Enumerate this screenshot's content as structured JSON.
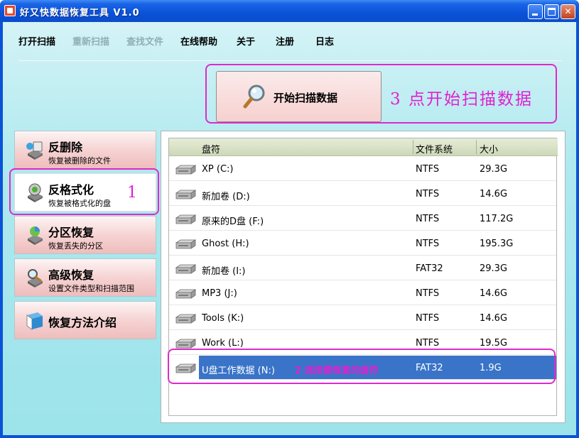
{
  "window": {
    "title": "好又快数据恢复工具 V1.0"
  },
  "menu": [
    {
      "label": "打开扫描",
      "enabled": true
    },
    {
      "label": "重新扫描",
      "enabled": false
    },
    {
      "label": "查找文件",
      "enabled": false
    },
    {
      "label": "在线帮助",
      "enabled": true
    },
    {
      "label": "关于",
      "enabled": true
    },
    {
      "label": "注册",
      "enabled": true
    },
    {
      "label": "日志",
      "enabled": true
    }
  ],
  "scan": {
    "label": "开始扫描数据",
    "annotation": "3 点开始扫描数据"
  },
  "sidebar": {
    "items": [
      {
        "title": "反删除",
        "subtitle": "恢复被删除的文件",
        "icon": "undelete-icon",
        "active": false
      },
      {
        "title": "反格式化",
        "subtitle": "恢复被格式化的盘",
        "icon": "unformat-icon",
        "active": true
      },
      {
        "title": "分区恢复",
        "subtitle": "恢复丢失的分区",
        "icon": "partition-icon",
        "active": false
      },
      {
        "title": "高级恢复",
        "subtitle": "设置文件类型和扫描范围",
        "icon": "advanced-icon",
        "active": false
      },
      {
        "title": "恢复方法介绍",
        "subtitle": "",
        "icon": "book-icon",
        "active": false
      }
    ],
    "annotation": "1"
  },
  "drives": {
    "columns": {
      "name": "盘符",
      "fs": "文件系统",
      "size": "大小"
    },
    "rows": [
      {
        "name": "XP (C:)",
        "fs": "NTFS",
        "size": "29.3G"
      },
      {
        "name": "新加卷 (D:)",
        "fs": "NTFS",
        "size": "14.6G"
      },
      {
        "name": "原来的D盘 (F:)",
        "fs": "NTFS",
        "size": "117.2G"
      },
      {
        "name": "Ghost (H:)",
        "fs": "NTFS",
        "size": "195.3G"
      },
      {
        "name": "新加卷 (I:)",
        "fs": "FAT32",
        "size": "29.3G"
      },
      {
        "name": "MP3 (J:)",
        "fs": "NTFS",
        "size": "14.6G"
      },
      {
        "name": "Tools (K:)",
        "fs": "NTFS",
        "size": "14.6G"
      },
      {
        "name": "Work (L:)",
        "fs": "NTFS",
        "size": "19.5G"
      },
      {
        "name": "U盘工作数据 (N:)",
        "fs": "FAT32",
        "size": "1.9G",
        "selected": true,
        "annotation": "2 选择要恢复的盘符"
      }
    ]
  },
  "colors": {
    "annotation": "#e020d0",
    "selection": "#3a74c8",
    "titlebar": "#0a52d8"
  }
}
